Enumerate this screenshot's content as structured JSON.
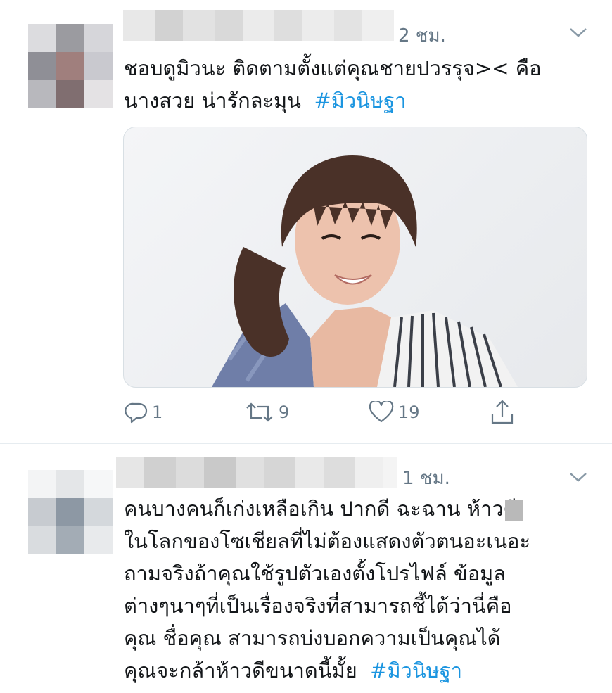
{
  "tweets": [
    {
      "time": "2 ชม.",
      "text_lines": [
        "ชอบดูมิวนะ ติดตามตั้งแต่คุณชายปวรรุจ>< คือ",
        "นางสวย น่ารักละมุน"
      ],
      "hashtag": "#มิวนิษฐา",
      "has_photo": true,
      "actions": {
        "reply_count": "1",
        "retweet_count": "9",
        "like_count": "19"
      }
    },
    {
      "time": "1 ชม.",
      "text_lines": [
        "คนบางคนก็เก่งเหลือเกิน ปากดี ฉะฉาน ห้าวดี",
        "ในโลกของโซเชียลที่ไม่ต้องแสดงตัวตนอะเนอะ",
        "ถามจริงถ้าคุณใช้รูปตัวเองตั้งโปรไฟล์ ข้อมูล",
        "ต่างๆนาๆที่เป็นเรื่องจริงที่สามารถชี้ได้ว่านี่คือ",
        "คุณ ชื่อคุณ สามารถบ่งบอกความเป็นคุณได้",
        "คุณจะกล้าห้าวดีขนาดนี้มั้ย"
      ],
      "hashtag": "#มิวนิษฐา"
    }
  ],
  "colors": {
    "text": "#14171a",
    "secondary": "#657786",
    "hashtag": "#1b95e0",
    "separator": "#e6ecf0"
  },
  "icons": {
    "more": "chevron-down-icon",
    "reply": "reply-icon",
    "retweet": "retweet-icon",
    "like": "heart-icon",
    "share": "share-icon"
  }
}
